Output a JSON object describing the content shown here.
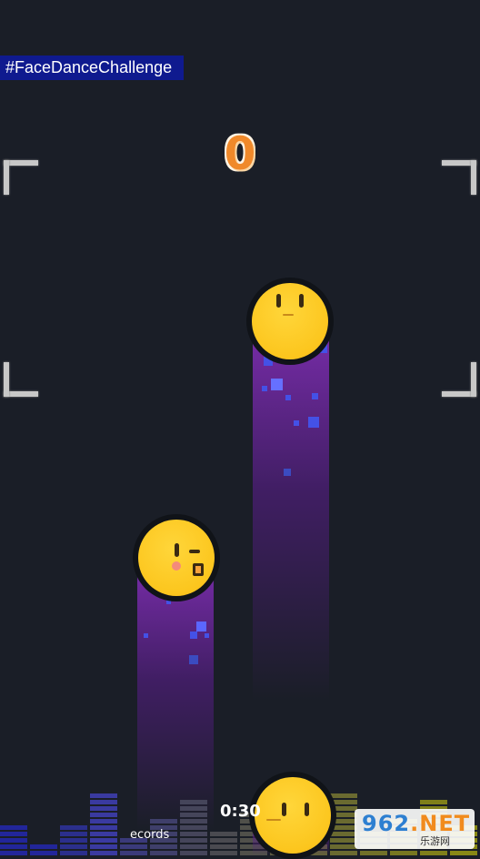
{
  "hashtag": "#FaceDanceChallenge",
  "score": "0",
  "timer": "0:30",
  "records_label": "ecords",
  "watermark": {
    "brand_number": "962",
    "brand_suffix": ".NET",
    "subtitle": "乐游网"
  },
  "emojis": [
    {
      "expression": "neutral-face"
    },
    {
      "expression": "kiss-wink-face"
    },
    {
      "expression": "neutral-face"
    }
  ],
  "colors": {
    "background": "#1a1e27",
    "hashtag_bg": "#0f1a8f",
    "score": "#f0892a",
    "emoji": "#fcc61e",
    "trail": "#802eb4"
  }
}
